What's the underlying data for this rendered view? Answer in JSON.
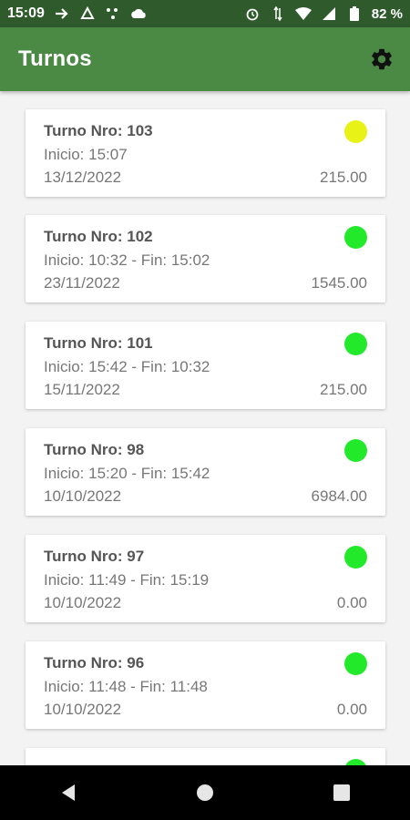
{
  "status_bar": {
    "time": "15:09",
    "battery_text": "82 %",
    "icons_left": [
      "arrow-right-icon",
      "recycle-icon",
      "dots-icon",
      "cloud-icon"
    ],
    "icons_right": [
      "alarm-icon",
      "data-arrows-icon",
      "wifi-icon",
      "signal-icon",
      "battery-icon"
    ]
  },
  "app_bar": {
    "title": "Turnos",
    "settings_icon": "gear-icon"
  },
  "turnos": [
    {
      "title": "Turno Nro: 103",
      "times": "Inicio: 15:07",
      "date": "13/12/2022",
      "amount": "215.00",
      "status_color": "#e9f217"
    },
    {
      "title": "Turno Nro: 102",
      "times": "Inicio: 10:32 - Fin: 15:02",
      "date": "23/11/2022",
      "amount": "1545.00",
      "status_color": "#22ea2b"
    },
    {
      "title": "Turno Nro: 101",
      "times": "Inicio: 15:42 - Fin: 10:32",
      "date": "15/11/2022",
      "amount": "215.00",
      "status_color": "#22ea2b"
    },
    {
      "title": "Turno Nro: 98",
      "times": "Inicio: 15:20 - Fin: 15:42",
      "date": "10/10/2022",
      "amount": "6984.00",
      "status_color": "#22ea2b"
    },
    {
      "title": "Turno Nro: 97",
      "times": "Inicio: 11:49 - Fin: 15:19",
      "date": "10/10/2022",
      "amount": "0.00",
      "status_color": "#22ea2b"
    },
    {
      "title": "Turno Nro: 96",
      "times": "Inicio: 11:48 - Fin: 11:48",
      "date": "10/10/2022",
      "amount": "0.00",
      "status_color": "#22ea2b"
    },
    {
      "title": "",
      "times": "",
      "date": "",
      "amount": "",
      "status_color": "#22ea2b"
    }
  ],
  "nav_bar": {
    "buttons": [
      "back-icon",
      "home-icon",
      "recents-icon"
    ]
  },
  "colors": {
    "app_bar": "#4a8a44",
    "status_bar": "#2e5a2c",
    "active": "#22ea2b",
    "open": "#e9f217"
  }
}
